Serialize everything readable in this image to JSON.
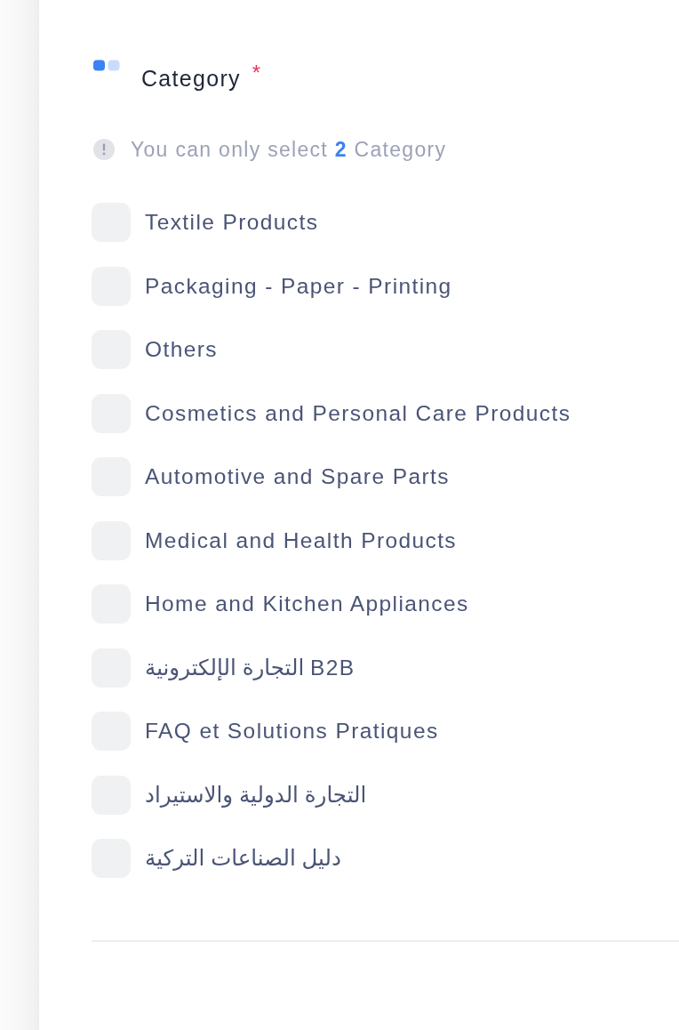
{
  "field": {
    "label": "Category",
    "required_mark": "*"
  },
  "hint": {
    "text": "You can only select **2** Category"
  },
  "categories": [
    {
      "label": "Textile Products",
      "checked": false
    },
    {
      "label": "Packaging - Paper - Printing",
      "checked": false
    },
    {
      "label": "Others",
      "checked": false
    },
    {
      "label": "Cosmetics and Personal Care Products",
      "checked": false
    },
    {
      "label": "Automotive and Spare Parts",
      "checked": false
    },
    {
      "label": "Medical and Health Products",
      "checked": false
    },
    {
      "label": "Home and Kitchen Appliances",
      "checked": false
    },
    {
      "label": "التجارة الإلكترونية B2B",
      "checked": false
    },
    {
      "label": "FAQ et Solutions Pratiques",
      "checked": false
    },
    {
      "label": "التجارة الدولية والاستيراد",
      "checked": false
    },
    {
      "label": "دليل الصناعات التركية",
      "checked": false
    }
  ]
}
